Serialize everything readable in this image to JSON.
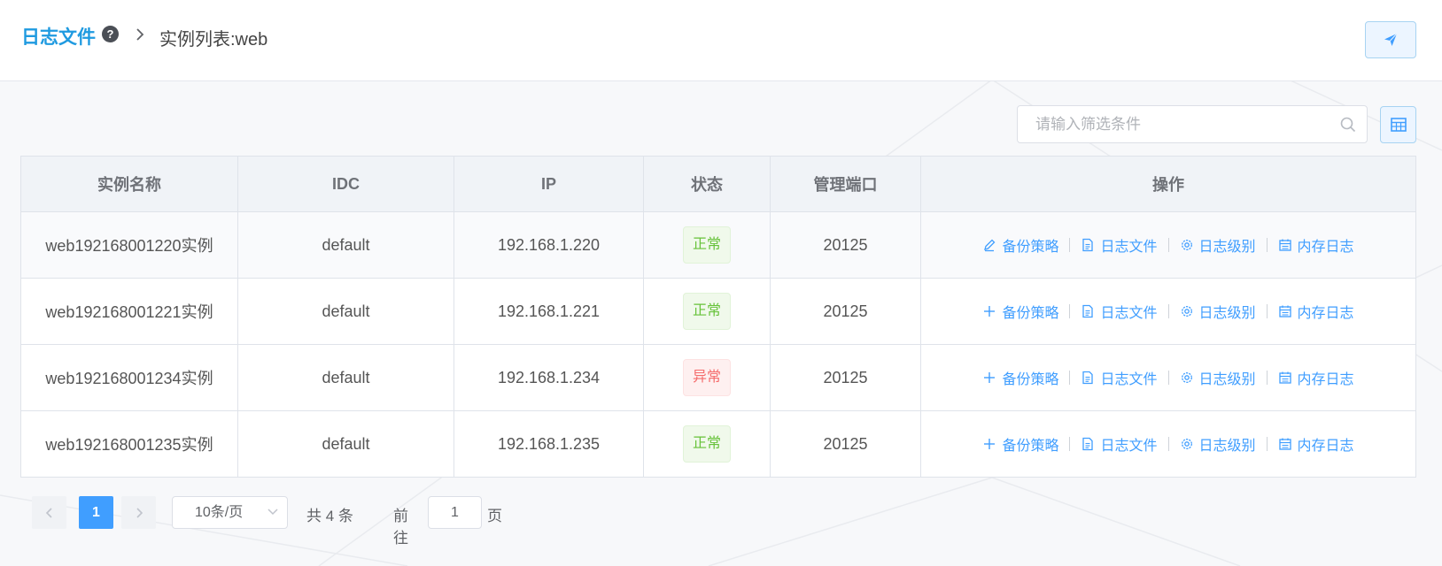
{
  "breadcrumb": {
    "root": "日志文件",
    "current": "实例列表:web"
  },
  "icons": {
    "help": "question-circle-icon",
    "separator": "chevron-right-icon",
    "send": "paper-plane-icon",
    "search": "search-icon",
    "table_toggle": "table-icon"
  },
  "search": {
    "placeholder": "请输入筛选条件",
    "value": ""
  },
  "table": {
    "headers": [
      "实例名称",
      "IDC",
      "IP",
      "状态",
      "管理端口",
      "操作"
    ],
    "rows": [
      {
        "name": "web192168001220实例",
        "idc": "default",
        "ip": "192.168.1.220",
        "status": "正常",
        "status_type": "ok",
        "port": "20125"
      },
      {
        "name": "web192168001221实例",
        "idc": "default",
        "ip": "192.168.1.221",
        "status": "正常",
        "status_type": "ok",
        "port": "20125"
      },
      {
        "name": "web192168001234实例",
        "idc": "default",
        "ip": "192.168.1.234",
        "status": "异常",
        "status_type": "bad",
        "port": "20125"
      },
      {
        "name": "web192168001235实例",
        "idc": "default",
        "ip": "192.168.1.235",
        "status": "正常",
        "status_type": "ok",
        "port": "20125"
      }
    ],
    "actions": {
      "backup": "备份策略",
      "log_file": "日志文件",
      "log_level": "日志级别",
      "memory_log": "内存日志"
    }
  },
  "pagination": {
    "current_page": "1",
    "page_size": "10条/页",
    "total": "共 4 条",
    "goto_label": "前往",
    "goto_value": "1",
    "page_suffix": "页"
  },
  "colors": {
    "accent": "#409eff",
    "title": "#1f9ae0",
    "ok": "#67c23a",
    "bad": "#f56c6c"
  }
}
